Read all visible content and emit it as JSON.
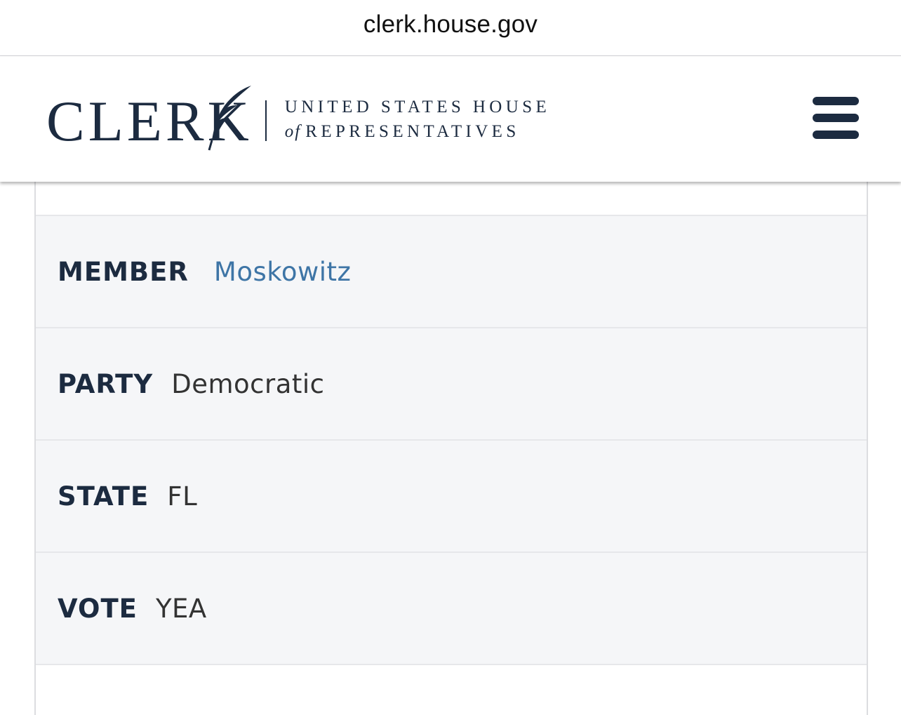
{
  "browser": {
    "url": "clerk.house.gov"
  },
  "header": {
    "logo_word": "CLERK",
    "logo_line1": "UNITED STATES HOUSE",
    "logo_of": "of",
    "logo_line2": "REPRESENTATIVES",
    "menu_icon": "hamburger-menu-icon"
  },
  "vote_record": {
    "member": {
      "label": "MEMBER",
      "value": "Moskowitz"
    },
    "party": {
      "label": "PARTY",
      "value": "Democratic"
    },
    "state": {
      "label": "STATE",
      "value": "FL"
    },
    "vote": {
      "label": "VOTE",
      "value": "YEA"
    }
  },
  "colors": {
    "navy": "#1c2b40",
    "link_blue": "#3e75a6",
    "row_background": "#f5f6f8",
    "divider": "#e6e7ea"
  }
}
